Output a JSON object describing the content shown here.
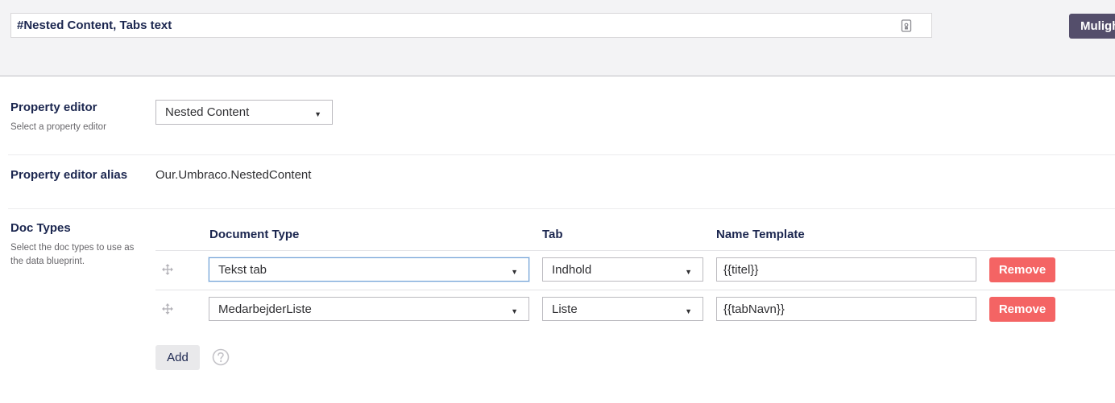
{
  "header": {
    "name_value": "#Nested Content, Tabs text",
    "lock_icon": "lock-icon",
    "action_label": "Mulighed"
  },
  "property_editor": {
    "title": "Property editor",
    "description": "Select a property editor",
    "selected": "Nested Content"
  },
  "property_alias": {
    "title": "Property editor alias",
    "value": "Our.Umbraco.NestedContent"
  },
  "doc_types": {
    "title": "Doc Types",
    "description": "Select the doc types to use as the data blueprint.",
    "columns": [
      "Document Type",
      "Tab",
      "Name Template"
    ],
    "rows": [
      {
        "document_type": "Tekst tab",
        "tab": "Indhold",
        "name_template": "{{titel}}",
        "remove_label": "Remove"
      },
      {
        "document_type": "MedarbejderListe",
        "tab": "Liste",
        "name_template": "{{tabNavn}}",
        "remove_label": "Remove"
      }
    ],
    "add_label": "Add",
    "help_icon": "question-circle-icon"
  },
  "colors": {
    "header_bg": "#f3f3f5",
    "action_button": "#544e6b",
    "remove_button": "#f46464",
    "text_primary": "#1b264f",
    "focus_border": "#6ea0d6"
  }
}
